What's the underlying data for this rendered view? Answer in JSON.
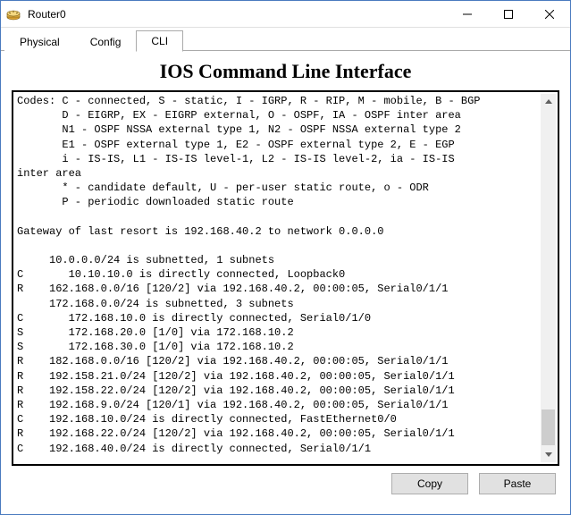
{
  "window": {
    "title": "Router0",
    "icon": "router-icon"
  },
  "tabs": {
    "items": [
      {
        "label": "Physical"
      },
      {
        "label": "Config"
      },
      {
        "label": "CLI"
      }
    ],
    "active_index": 2
  },
  "cli": {
    "heading": "IOS Command Line Interface",
    "text": "Codes: C - connected, S - static, I - IGRP, R - RIP, M - mobile, B - BGP\n       D - EIGRP, EX - EIGRP external, O - OSPF, IA - OSPF inter area\n       N1 - OSPF NSSA external type 1, N2 - OSPF NSSA external type 2\n       E1 - OSPF external type 1, E2 - OSPF external type 2, E - EGP\n       i - IS-IS, L1 - IS-IS level-1, L2 - IS-IS level-2, ia - IS-IS\ninter area\n       * - candidate default, U - per-user static route, o - ODR\n       P - periodic downloaded static route\n\nGateway of last resort is 192.168.40.2 to network 0.0.0.0\n\n     10.0.0.0/24 is subnetted, 1 subnets\nC       10.10.10.0 is directly connected, Loopback0\nR    162.168.0.0/16 [120/2] via 192.168.40.2, 00:00:05, Serial0/1/1\n     172.168.0.0/24 is subnetted, 3 subnets\nC       172.168.10.0 is directly connected, Serial0/1/0\nS       172.168.20.0 [1/0] via 172.168.10.2\nS       172.168.30.0 [1/0] via 172.168.10.2\nR    182.168.0.0/16 [120/2] via 192.168.40.2, 00:00:05, Serial0/1/1\nR    192.158.21.0/24 [120/2] via 192.168.40.2, 00:00:05, Serial0/1/1\nR    192.158.22.0/24 [120/2] via 192.168.40.2, 00:00:05, Serial0/1/1\nR    192.168.9.0/24 [120/1] via 192.168.40.2, 00:00:05, Serial0/1/1\nC    192.168.10.0/24 is directly connected, FastEthernet0/0\nR    192.168.22.0/24 [120/2] via 192.168.40.2, 00:00:05, Serial0/1/1\nC    192.168.40.0/24 is directly connected, Serial0/1/1"
  },
  "buttons": {
    "copy": "Copy",
    "paste": "Paste"
  }
}
